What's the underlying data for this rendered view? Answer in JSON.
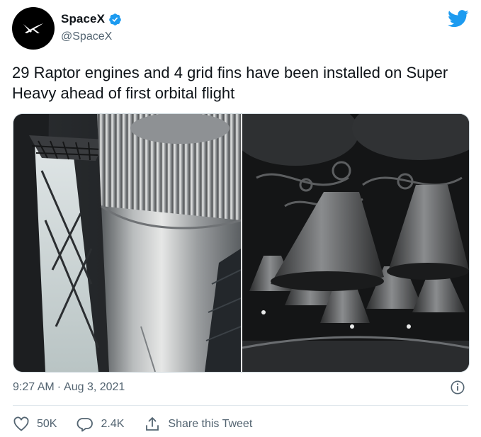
{
  "author": {
    "display_name": "SpaceX",
    "handle": "@SpaceX",
    "verified": true,
    "avatar_icon": "spacex-logo-icon"
  },
  "tweet": {
    "text": "29 Raptor engines and 4 grid fins have been installed on Super Heavy ahead of first orbital flight",
    "time": "9:27 AM",
    "separator": "·",
    "date": "Aug 3, 2021"
  },
  "media": [
    {
      "description_icon": "super-heavy-booster-photo"
    },
    {
      "description_icon": "raptor-engines-photo"
    }
  ],
  "actions": {
    "like_count": "50K",
    "reply_count": "2.4K",
    "share_label": "Share this Tweet"
  },
  "colors": {
    "twitter_blue": "#1d9bf0",
    "secondary_text": "#536471",
    "heart": "#536471"
  },
  "icons": [
    "twitter-bird-icon",
    "verified-badge-icon",
    "info-icon",
    "heart-icon",
    "reply-icon",
    "share-icon"
  ]
}
